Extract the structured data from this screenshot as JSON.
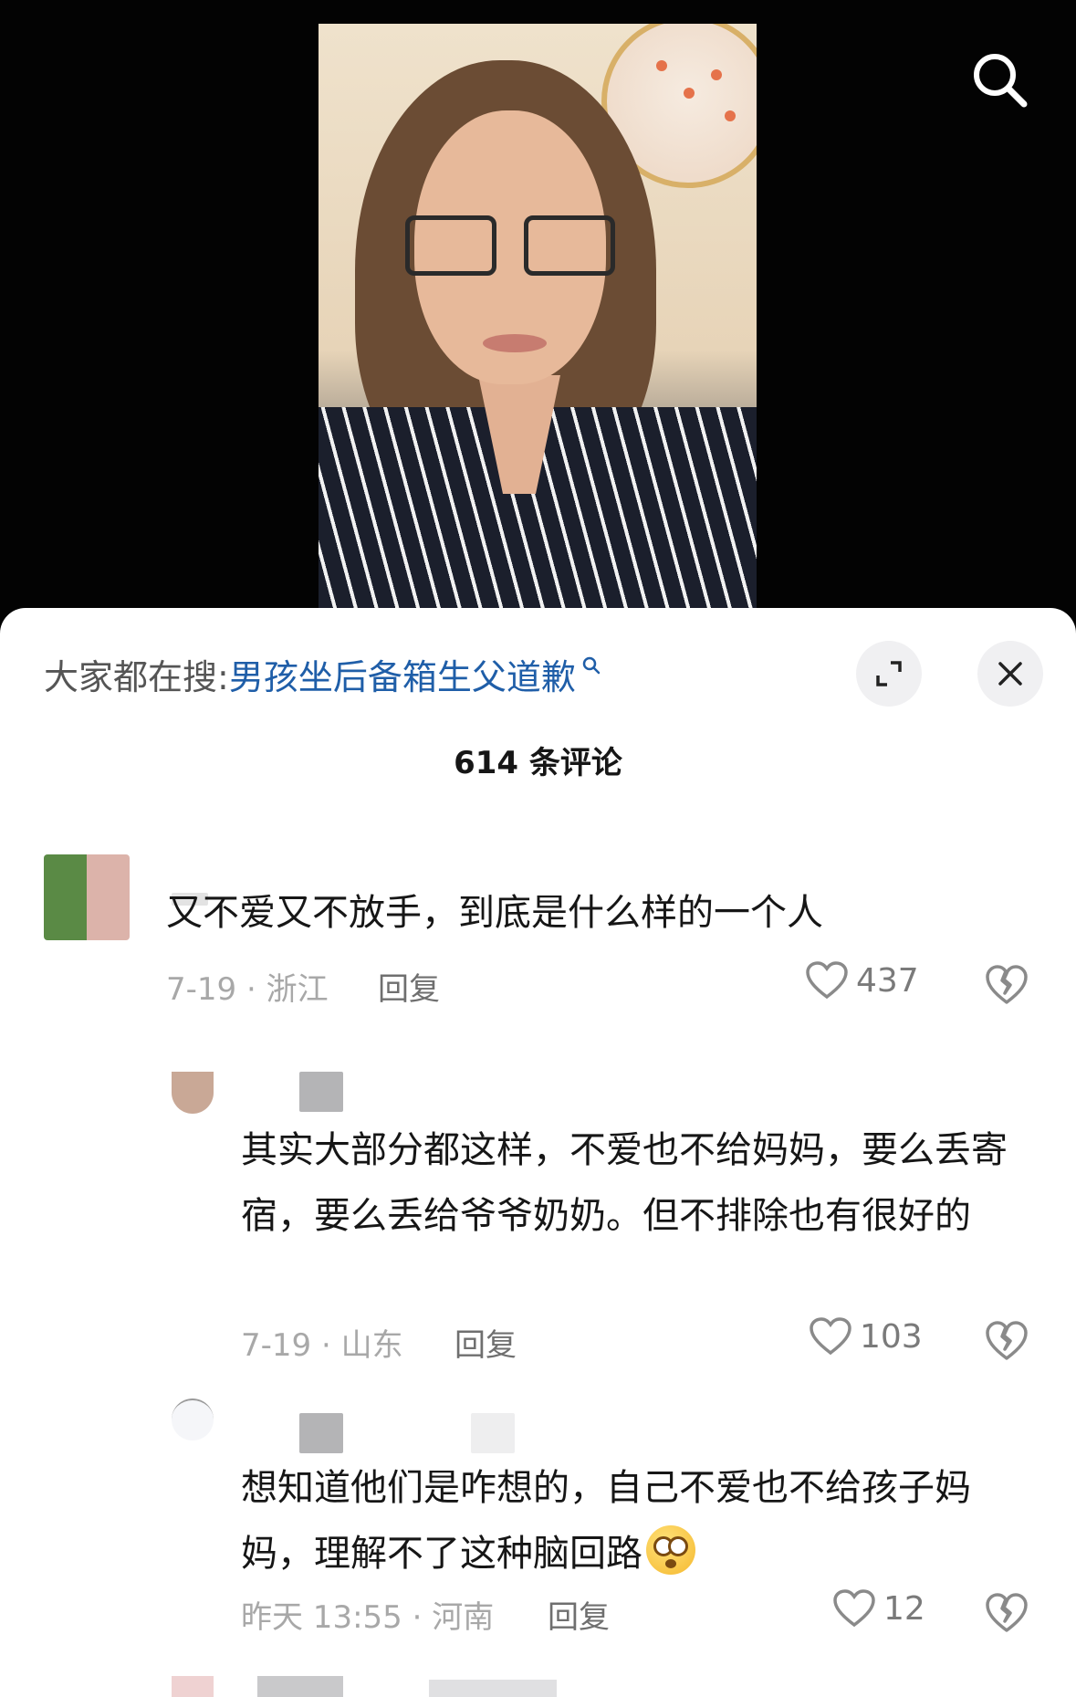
{
  "header": {
    "search_prefix": "大家都在搜:",
    "search_query": "男孩坐后备箱生父道歉",
    "comment_count_label": "614 条评论"
  },
  "icons": {
    "top_search": "search-icon",
    "expand": "expand-icon",
    "close": "close-icon",
    "like": "heart-icon",
    "dislike": "broken-heart-icon"
  },
  "colors": {
    "accent_link": "#1f5ea8",
    "sheet_background": "#ffffff",
    "video_background": "#030303"
  },
  "comments": [
    {
      "text": "又不爱又不放手，到底是什么样的一个人",
      "meta": "7-19 · 浙江",
      "reply_label": "回复",
      "likes": "437"
    },
    {
      "text": "其实大部分都这样，不爱也不给妈妈，要么丢寄宿，要么丢给爷爷奶奶。但不排除也有很好的",
      "meta": "7-19 · 山东",
      "reply_label": "回复",
      "likes": "103"
    },
    {
      "text": "想知道他们是咋想的，自己不爱也不给孩子妈妈，理解不了这种脑回路",
      "emoji": "dizzy-face-emoji",
      "meta": "昨天 13:55 · 河南",
      "reply_label": "回复",
      "likes": "12"
    }
  ]
}
